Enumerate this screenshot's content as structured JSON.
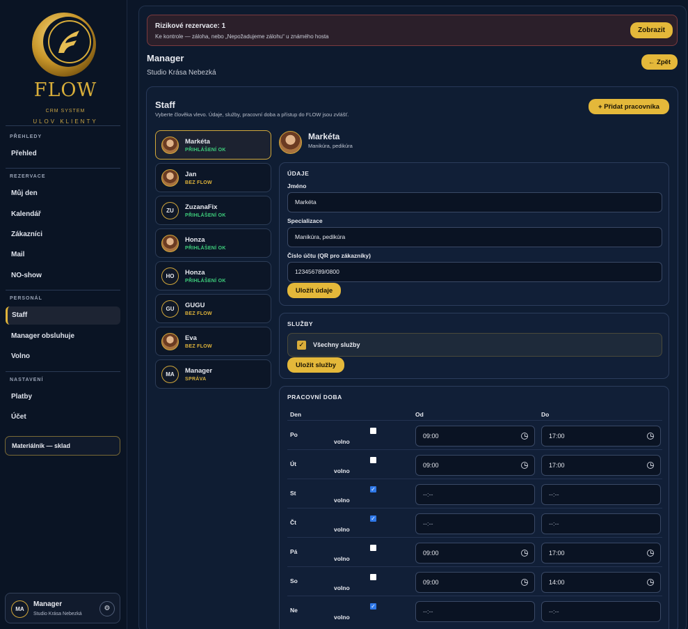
{
  "brand": {
    "name": "FLOW",
    "subtitle": "CRM SYSTEM",
    "tagline": "ULOV KLIENTY"
  },
  "sidebar": {
    "sections": [
      {
        "title": "PŘEHLEDY",
        "items": [
          "Přehled"
        ]
      },
      {
        "title": "REZERVACE",
        "items": [
          "Můj den",
          "Kalendář",
          "Zákazníci",
          "Mail",
          "NO-show"
        ]
      },
      {
        "title": "PERSONÁL",
        "items": [
          "Staff",
          "Manager obsluhuje",
          "Volno"
        ]
      },
      {
        "title": "NASTAVENÍ",
        "items": [
          "Platby",
          "Účet"
        ]
      }
    ],
    "active": "Staff",
    "material_button": "Materiálník — sklad",
    "user": {
      "initials": "MA",
      "name": "Manager",
      "studio": "Studio Krása Nebezká",
      "gear": "⚙"
    }
  },
  "alert": {
    "title": "Rizikové rezervace: 1",
    "text": "Ke kontrole — záloha, nebo „Nepožadujeme zálohu“ u známého hosta",
    "button": "Zobrazit"
  },
  "header": {
    "title": "Manager",
    "studio": "Studio Krása Nebezká",
    "back_button": "← Zpět"
  },
  "staff": {
    "title": "Staff",
    "description": "Vyberte člověka vlevo. Údaje, služby, pracovní doba a přístup do FLOW jsou zvlášť.",
    "add_button": "+ Přidat pracovníka",
    "list": [
      {
        "name": "Markéta",
        "status": "PŘIHLÁŠENÍ OK",
        "status_type": "ok",
        "avatar": "photo",
        "selected": true
      },
      {
        "name": "Jan",
        "status": "BEZ FLOW",
        "status_type": "warn",
        "avatar": "photo"
      },
      {
        "name": "ZuzanaFix",
        "status": "PŘIHLÁŠENÍ OK",
        "status_type": "ok",
        "initials": "ZU"
      },
      {
        "name": "Honza",
        "status": "PŘIHLÁŠENÍ OK",
        "status_type": "ok",
        "avatar": "photo"
      },
      {
        "name": "Honza",
        "status": "PŘIHLÁŠENÍ OK",
        "status_type": "ok",
        "initials": "HO"
      },
      {
        "name": "GUGU",
        "status": "BEZ FLOW",
        "status_type": "warn",
        "initials": "GU"
      },
      {
        "name": "Eva",
        "status": "BEZ FLOW",
        "status_type": "warn",
        "avatar": "photo"
      },
      {
        "name": "Manager",
        "status": "SPRÁVA",
        "status_type": "adm",
        "initials": "MA"
      }
    ]
  },
  "detail": {
    "name": "Markéta",
    "spec": "Manikúra, pedikúra",
    "udaje": {
      "heading": "ÚDAJE",
      "name_label": "Jméno",
      "name_value": "Markéta",
      "spec_label": "Specializace",
      "spec_value": "Manikúra, pedikúra",
      "account_label": "Číslo účtu (QR pro zákazníky)",
      "account_value": "123456789/0800",
      "save": "Uložit údaje"
    },
    "sluzby": {
      "heading": "SLUŽBY",
      "all": "Všechny služby",
      "checked": true,
      "save": "Uložit služby"
    },
    "hours": {
      "heading": "PRACOVNÍ DOBA",
      "col_day": "Den",
      "col_from": "Od",
      "col_to": "Do",
      "free_label": "volno",
      "empty_time": "--:--",
      "rows": [
        {
          "day": "Po",
          "free": false,
          "from": "09:00",
          "to": "17:00"
        },
        {
          "day": "Út",
          "free": false,
          "from": "09:00",
          "to": "17:00"
        },
        {
          "day": "St",
          "free": true,
          "from": "",
          "to": ""
        },
        {
          "day": "Čt",
          "free": true,
          "from": "",
          "to": ""
        },
        {
          "day": "Pá",
          "free": false,
          "from": "09:00",
          "to": "17:00"
        },
        {
          "day": "So",
          "free": false,
          "from": "09:00",
          "to": "14:00"
        },
        {
          "day": "Ne",
          "free": true,
          "from": "",
          "to": ""
        }
      ]
    }
  }
}
